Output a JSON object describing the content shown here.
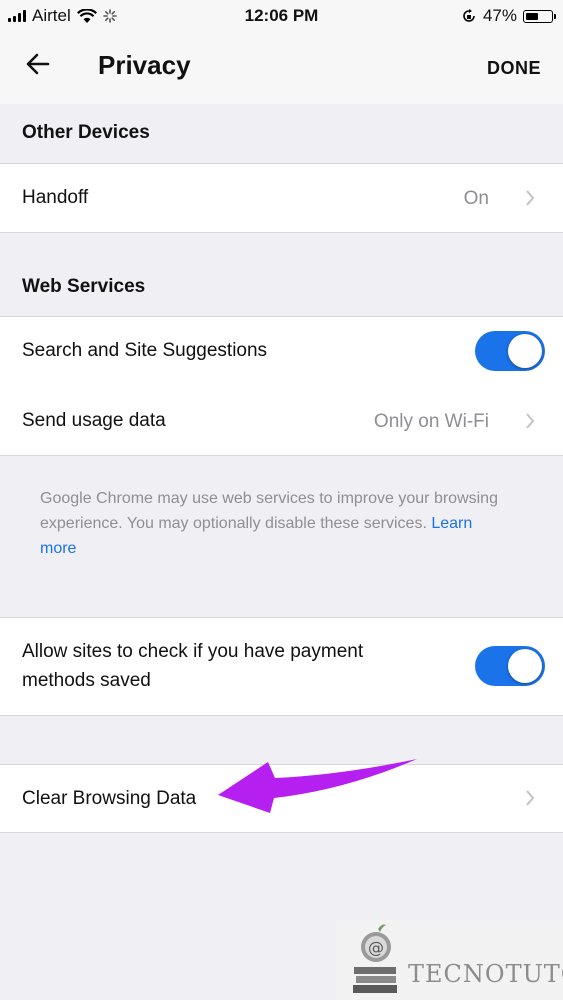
{
  "status_bar": {
    "carrier": "Airtel",
    "time": "12:06 PM",
    "battery_percent": "47%"
  },
  "nav": {
    "title": "Privacy",
    "done_label": "DONE"
  },
  "sections": {
    "other_devices": {
      "header": "Other Devices",
      "handoff": {
        "label": "Handoff",
        "value": "On"
      }
    },
    "web_services": {
      "header": "Web Services",
      "search_suggestions": {
        "label": "Search and Site Suggestions",
        "on": true
      },
      "usage_data": {
        "label": "Send usage data",
        "value": "Only on Wi-Fi"
      },
      "footnote": "Google Chrome may use web services to improve your browsing experience. You may optionally disable these services.",
      "learn_more": "Learn more"
    },
    "payment": {
      "label_line1": "Allow sites to check if you have payment",
      "label_line2": "methods saved",
      "on": true
    },
    "clear_data": {
      "label": "Clear Browsing Data"
    }
  },
  "watermark": {
    "text": "TECNOTUTO"
  },
  "colors": {
    "toggle_on": "#1a73e8",
    "link": "#1a73e8",
    "annotation_arrow": "#b51ff0",
    "background": "#efeff4"
  }
}
